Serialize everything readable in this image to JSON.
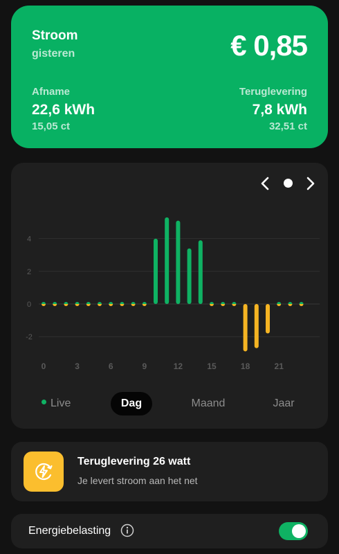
{
  "summary": {
    "title": "Stroom",
    "subtitle": "gisteren",
    "amount": "€ 0,85",
    "afname": {
      "label": "Afname",
      "value": "22,6 kWh",
      "price": "15,05 ct"
    },
    "teruglevering": {
      "label": "Teruglevering",
      "value": "7,8 kWh",
      "price": "32,51 ct"
    }
  },
  "chart_nav": {
    "prev_icon": "chevron-left-icon",
    "next_icon": "chevron-right-icon"
  },
  "chart_data": {
    "type": "bar",
    "categories": [
      "0",
      "1",
      "2",
      "3",
      "4",
      "5",
      "6",
      "7",
      "8",
      "9",
      "10",
      "11",
      "12",
      "13",
      "14",
      "15",
      "16",
      "17",
      "18",
      "19",
      "20",
      "21",
      "22",
      "23"
    ],
    "values": [
      0,
      0,
      0,
      0,
      0,
      0,
      0,
      0,
      0,
      0,
      4.0,
      5.3,
      5.1,
      3.4,
      3.9,
      0,
      0,
      0,
      -2.9,
      -2.7,
      -1.8,
      0,
      0,
      0
    ],
    "x_ticks": [
      "0",
      "3",
      "6",
      "9",
      "12",
      "15",
      "18",
      "21"
    ],
    "y_ticks": [
      "4",
      "2",
      "0",
      "-2"
    ],
    "ylim": [
      -3,
      5.5
    ],
    "colors": {
      "positive": "#0fb263",
      "negative": "#f5b423",
      "grid": "#333333",
      "tick": "#5a5a5a"
    }
  },
  "tabs": {
    "live": "Live",
    "dag": "Dag",
    "maand": "Maand",
    "jaar": "Jaar",
    "active": "Dag"
  },
  "feed": {
    "icon": "bolt-icon",
    "title": "Teruglevering 26 watt",
    "subtitle": "Je levert stroom aan het net"
  },
  "tax": {
    "label": "Energiebelasting",
    "info_icon": "info-icon",
    "enabled": true
  },
  "colors": {
    "accent": "#08b163",
    "feed_icon_bg": "#fbbe2e"
  }
}
